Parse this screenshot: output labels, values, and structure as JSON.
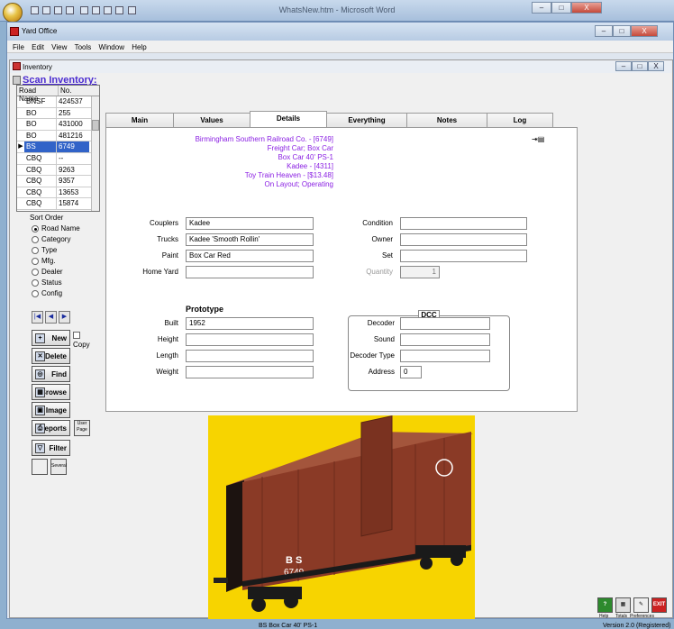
{
  "word": {
    "title": "WhatsNew.htm - Microsoft Word",
    "min_label": "–",
    "max_label": "□",
    "close_label": "X"
  },
  "app": {
    "title": "Yard Office",
    "menu": [
      "File",
      "Edit",
      "View",
      "Tools",
      "Window",
      "Help"
    ],
    "min_label": "–",
    "max_label": "□",
    "close_label": "X"
  },
  "inventory": {
    "title": "Inventory",
    "scan_title": "Scan Inventory:",
    "grid": {
      "headers": [
        "Road Name",
        "No."
      ],
      "rows": [
        [
          "BNSF",
          "424537"
        ],
        [
          "BO",
          "255"
        ],
        [
          "BO",
          "431000"
        ],
        [
          "BO",
          "481216"
        ],
        [
          "BS",
          "6749"
        ],
        [
          "CBQ",
          "--"
        ],
        [
          "CBQ",
          "9263"
        ],
        [
          "CBQ",
          "9357"
        ],
        [
          "CBQ",
          "13653"
        ],
        [
          "CBQ",
          "15874"
        ]
      ],
      "selected_index": 4
    },
    "sort": {
      "label": "Sort Order",
      "options": [
        "Road Name",
        "Category",
        "Type",
        "Mfg.",
        "Dealer",
        "Status",
        "Config"
      ],
      "selected": 0
    },
    "buttons": {
      "new": "New",
      "copy": "Copy",
      "delete": "Delete",
      "find": "Find",
      "browse": "Browse",
      "image": "Image",
      "reports": "Reports",
      "filter": "Filter",
      "several": "Several",
      "user_page": "User Page"
    },
    "tabs": [
      "Main",
      "Values",
      "Details",
      "Everything",
      "Notes",
      "Log"
    ],
    "active_tab": 2,
    "car_info": [
      "Birmingham Southern Railroad Co. - [6749]",
      "Freight Car; Box Car",
      "Box Car 40' PS-1",
      "Kadee - [4311]",
      "Toy Train Heaven - [$13.48]",
      "On Layout; Operating"
    ],
    "fields_left": [
      {
        "label": "Couplers",
        "value": "Kadee"
      },
      {
        "label": "Trucks",
        "value": "Kadee 'Smooth Rollin'"
      },
      {
        "label": "Paint",
        "value": "Box Car Red"
      },
      {
        "label": "Home Yard",
        "value": ""
      }
    ],
    "fields_right": [
      {
        "label": "Condition",
        "value": ""
      },
      {
        "label": "Owner",
        "value": ""
      },
      {
        "label": "Set",
        "value": ""
      },
      {
        "label": "Quantity",
        "value": "1"
      }
    ],
    "prototype": {
      "title": "Prototype",
      "fields": [
        {
          "label": "Built",
          "value": "1952"
        },
        {
          "label": "Height",
          "value": ""
        },
        {
          "label": "Length",
          "value": ""
        },
        {
          "label": "Weight",
          "value": ""
        }
      ]
    },
    "dcc": {
      "title": "DCC",
      "fields": [
        {
          "label": "Decoder",
          "value": ""
        },
        {
          "label": "Sound",
          "value": ""
        },
        {
          "label": "Decoder Type",
          "value": ""
        },
        {
          "label": "Address",
          "value": "0"
        }
      ]
    },
    "photo": {
      "caption": "BS Box Car 40' PS-1",
      "car_number": "6749",
      "car_letters": "B S",
      "background": "#f7d400",
      "car_color": "#8a3a26"
    },
    "bottom": {
      "help": "Help",
      "totals": "Totals",
      "preferences": "Preferences",
      "exit": "EXIT",
      "version": "Version 2.0 (Registered)"
    }
  }
}
